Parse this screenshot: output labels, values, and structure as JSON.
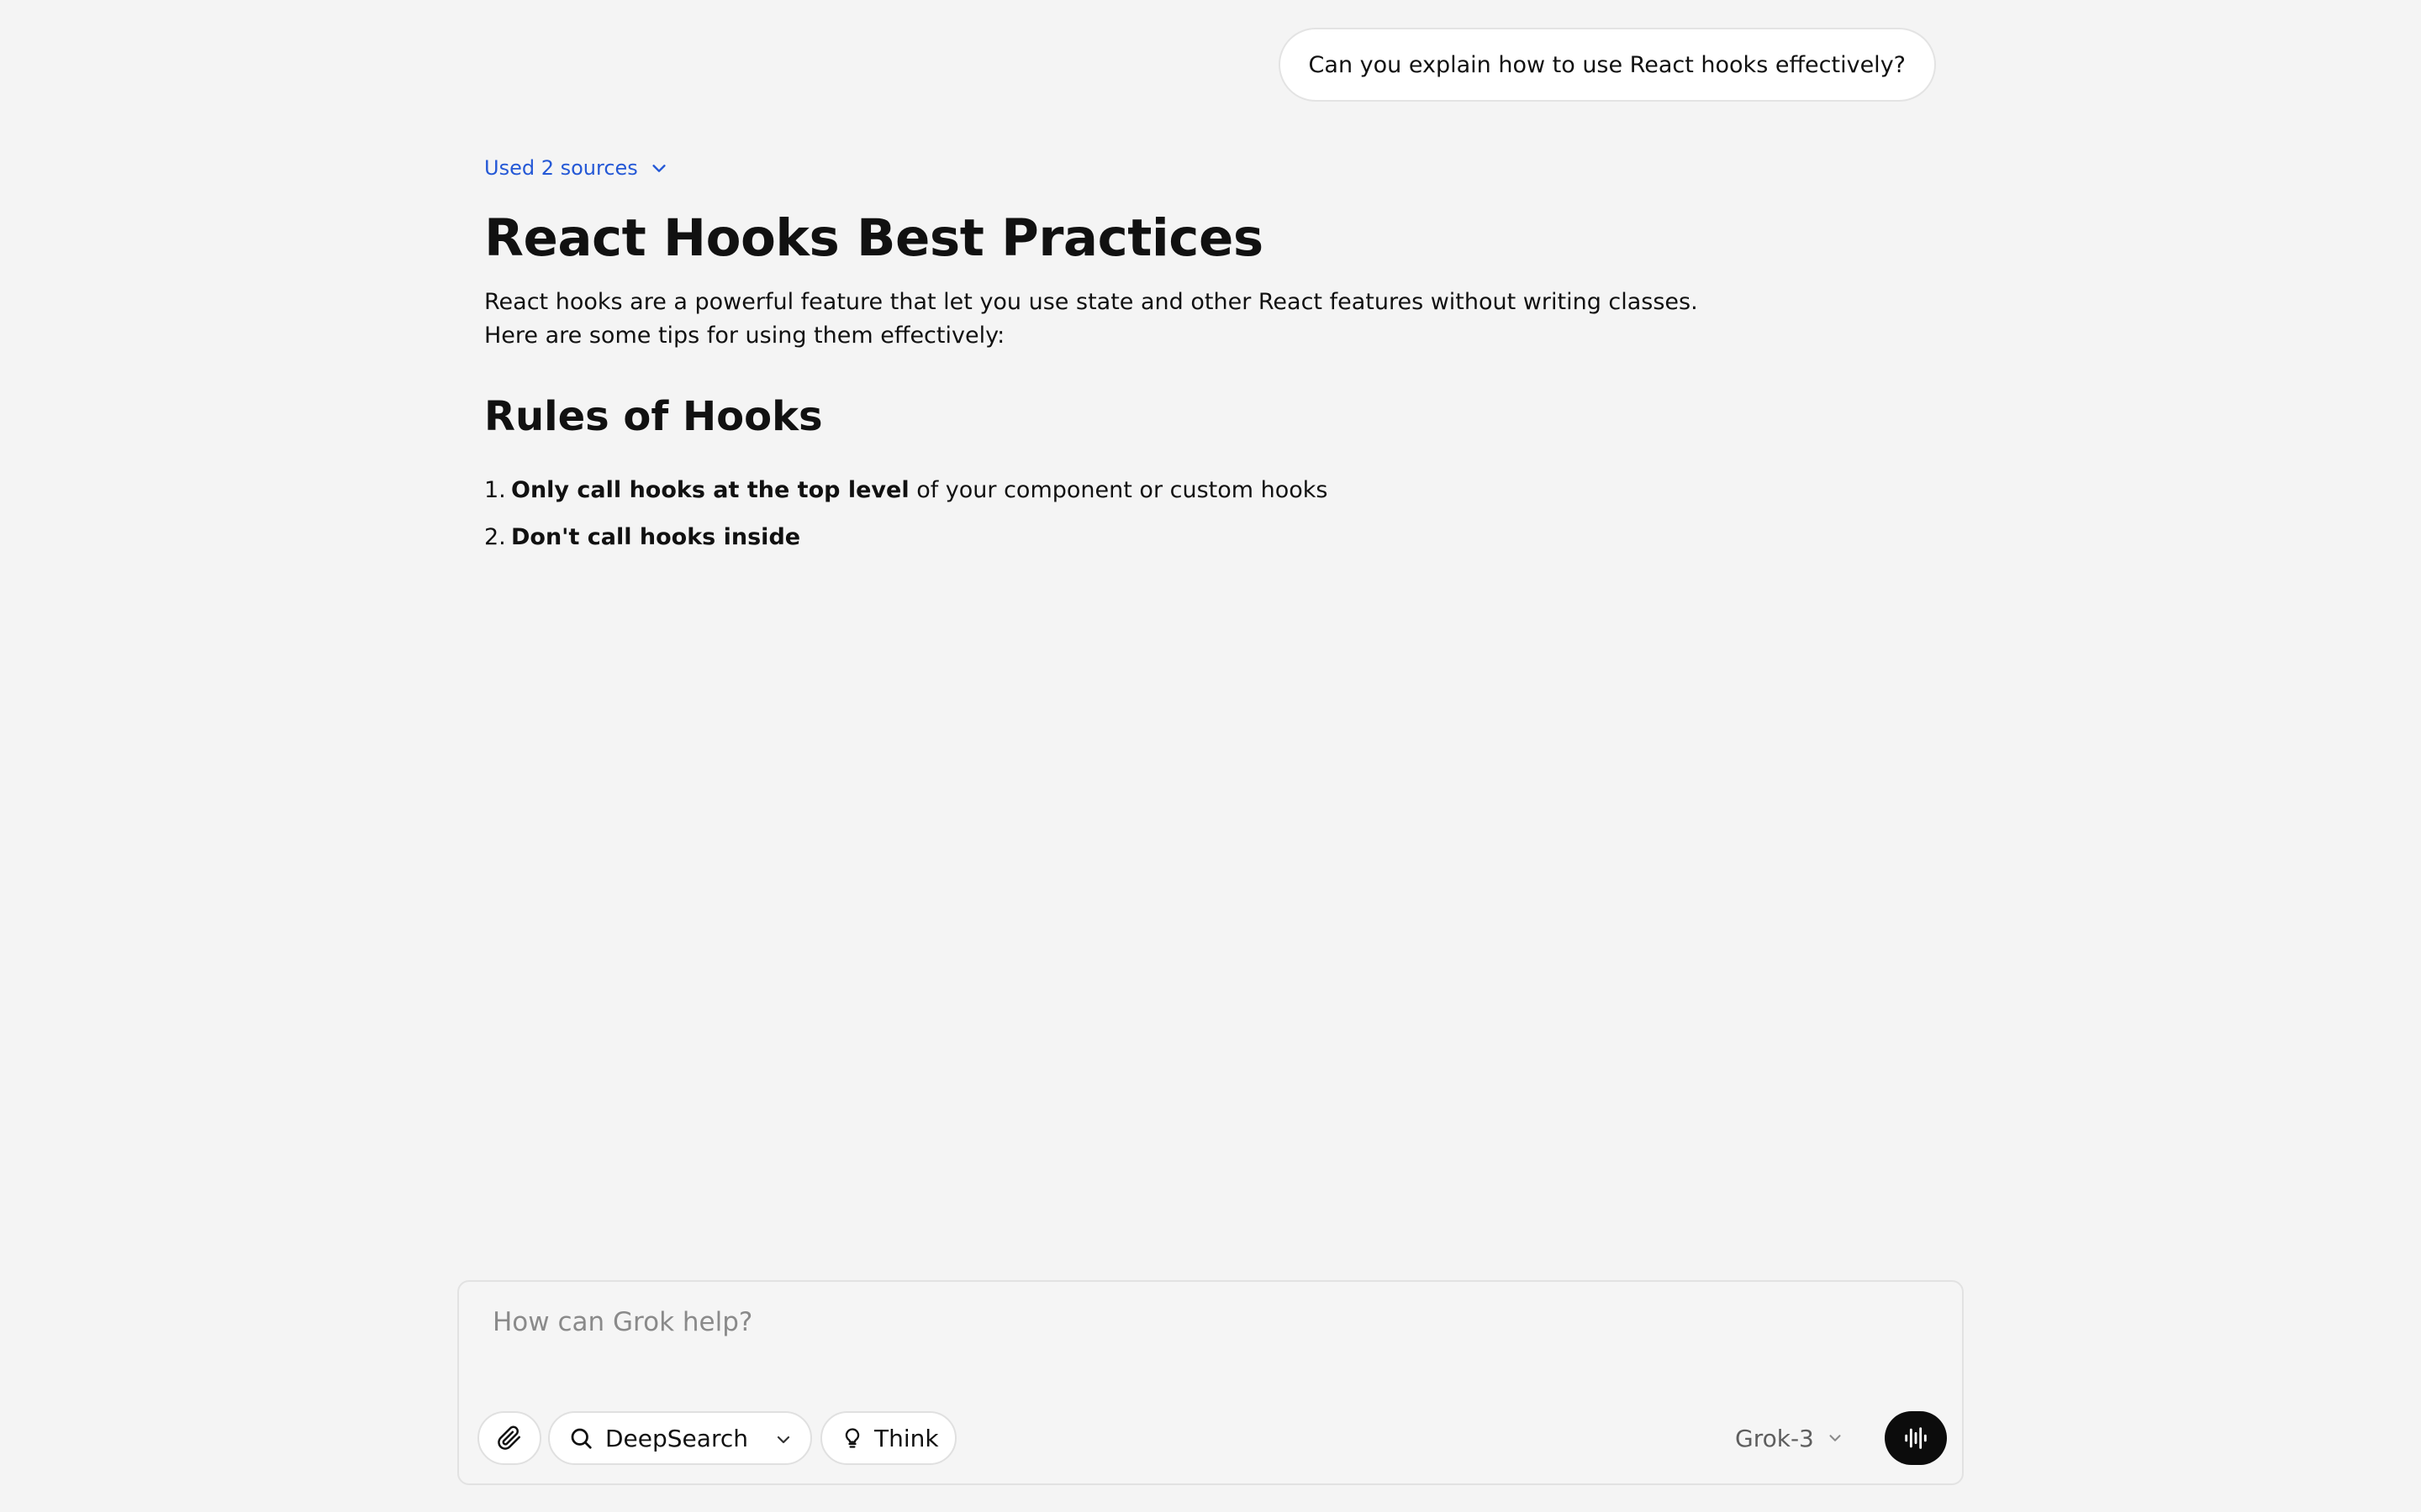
{
  "conversation": {
    "user_message": "Can you explain how to use React hooks effectively?"
  },
  "answer": {
    "sources_label": "Used 2 sources",
    "title": "React Hooks Best Practices",
    "intro_line1": "React hooks are a powerful feature that let you use state and other React features without writing classes.",
    "intro_line2": "Here are some tips for using them effectively:",
    "section_heading": "Rules of Hooks",
    "rules": [
      {
        "number": "1.",
        "bold": "Only call hooks at the top level",
        "rest": " of your component or custom hooks"
      },
      {
        "number": "2.",
        "bold": "Don't call hooks inside",
        "rest": ""
      }
    ]
  },
  "composer": {
    "placeholder": "How can Grok help?",
    "deepsearch_label": "DeepSearch",
    "think_label": "Think",
    "model_label": "Grok-3"
  },
  "icons": {
    "attach": "paperclip-icon",
    "search": "search-icon",
    "think": "lightbulb-icon",
    "voice": "voice-waveform-icon",
    "chevron": "chevron-down-icon"
  },
  "colors": {
    "background": "#f4f4f4",
    "link_blue": "#2458d6",
    "voice_button": "#0c0c0c"
  }
}
